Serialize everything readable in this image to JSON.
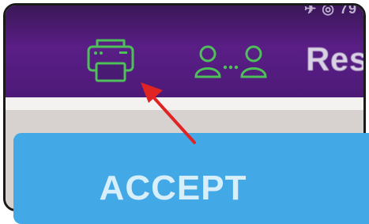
{
  "status_bar": {
    "indicators": "✈ ◎",
    "battery": "79"
  },
  "toolbar": {
    "print_icon": "printer-icon",
    "share_icon": "people-transfer-icon",
    "label": "Res",
    "icon_color": "#4fbf5a",
    "background": "#5a1e86"
  },
  "action": {
    "accept_label": "ACCEPT",
    "color": "#43a8e6"
  },
  "annotation": {
    "arrow_color": "#e02424"
  }
}
